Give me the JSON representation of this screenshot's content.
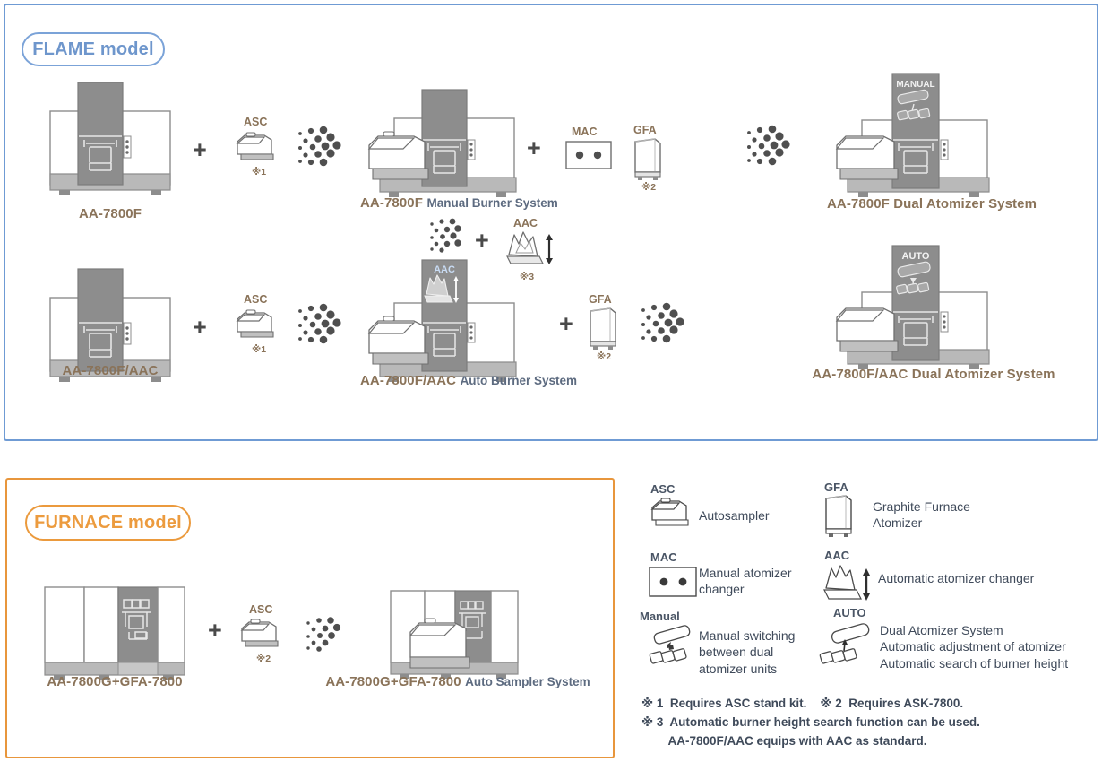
{
  "flame": {
    "badge": "FLAME model",
    "row1": {
      "base_model": "AA-7800F",
      "asc_tag": "ASC",
      "asc_note": "※1",
      "plus1": "+",
      "mid_model": "AA-7800F",
      "mid_suffix": "Manual Burner System",
      "plus2": "+",
      "mac_tag": "MAC",
      "gfa_tag": "GFA",
      "gfa_note": "※2",
      "tower_tag": "MANUAL",
      "result_model": "AA-7800F Dual Atomizer System"
    },
    "row2": {
      "base_model": "AA-7800F/AAC",
      "asc_tag": "ASC",
      "asc_note": "※1",
      "plus1": "+",
      "aac_tag": "AAC",
      "aac_note": "※3",
      "plus_aac": "+",
      "tower_aac_tag": "AAC",
      "mid_model": "AA-7800F/AAC",
      "mid_suffix": "Auto Burner System",
      "plus2": "+",
      "gfa_tag": "GFA",
      "gfa_note": "※2",
      "tower_tag": "AUTO",
      "result_model": "AA-7800F/AAC Dual Atomizer System"
    }
  },
  "furnace": {
    "badge": "FURNACE model",
    "base_model": "AA-7800G+GFA-7800",
    "plus": "+",
    "asc_tag": "ASC",
    "asc_note": "※2",
    "result_model": "AA-7800G+GFA-7800",
    "result_suffix": "Auto Sampler System"
  },
  "legend": {
    "items": [
      {
        "code": "ASC",
        "label": "Autosampler"
      },
      {
        "code": "GFA",
        "label": "Graphite Furnace\nAtomizer"
      },
      {
        "code": "MAC",
        "label": "Manual atomizer\nchanger"
      },
      {
        "code": "AAC",
        "label": "Automatic atomizer changer"
      },
      {
        "code": "Manual",
        "label": "Manual switching\nbetween dual\natomizer units"
      },
      {
        "code": "AUTO",
        "label": "Dual Atomizer System\nAutomatic adjustment of atomizer\nAutomatic search of burner height"
      }
    ],
    "footnotes": [
      "※ 1  Requires ASC stand kit.    ※ 2  Requires ASK-7800.",
      "※ 3  Automatic burner height search function can be used.",
      "        AA-7800F/AAC equips with AAC as standard."
    ]
  },
  "colors": {
    "flame_border": "#6f9bd4",
    "furnace_border": "#e8963c",
    "model_text": "#8a7359",
    "body_text": "#3f4a5a",
    "tower_gray": "#8d8d8d",
    "base_gray": "#b5b5b5"
  }
}
